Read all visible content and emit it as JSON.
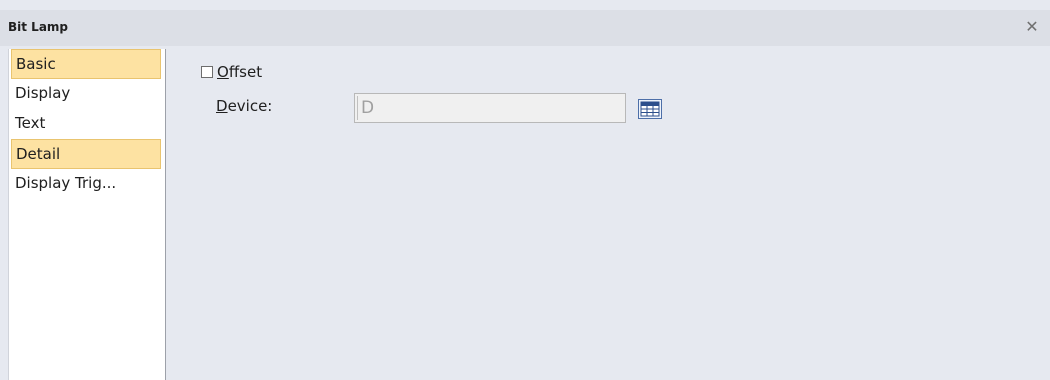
{
  "window": {
    "title": "Bit Lamp",
    "close_symbol": "✕"
  },
  "sidebar": {
    "items": [
      {
        "label": "Basic",
        "selected": true
      },
      {
        "label": "Display",
        "selected": false
      },
      {
        "label": "Text",
        "selected": false
      },
      {
        "label": "Detail",
        "selected": true
      },
      {
        "label": "Display Trig...",
        "selected": false
      }
    ]
  },
  "offset": {
    "label_mnemonic": "O",
    "label_rest": "ffset",
    "checked": false
  },
  "device": {
    "label_mnemonic": "D",
    "label_rest": "evice:",
    "value": "D",
    "button_icon": "device-browse-icon"
  },
  "colors": {
    "selected_item_bg": "#fde2a2",
    "window_bg": "#e6e9f0"
  }
}
